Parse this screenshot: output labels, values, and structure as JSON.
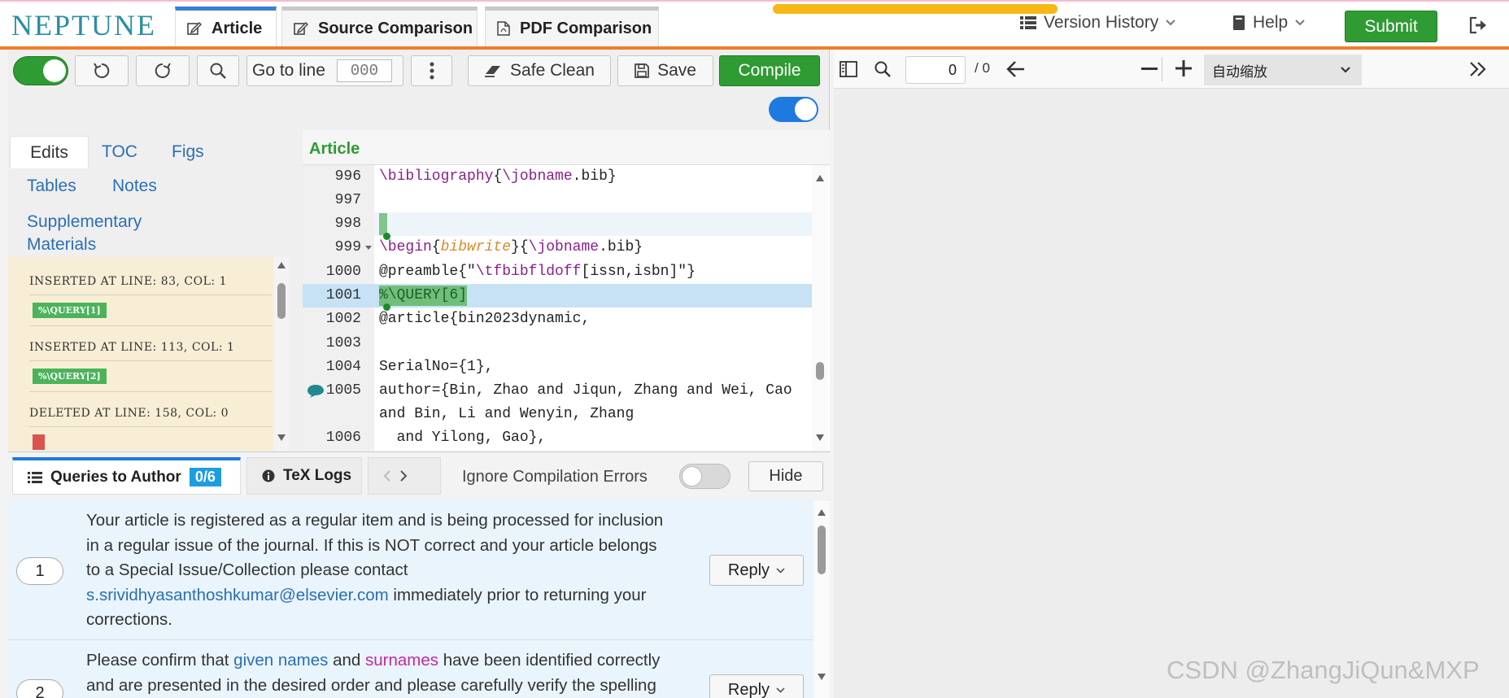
{
  "logo": "NEPTUNE",
  "top_tabs": [
    {
      "label": "Article"
    },
    {
      "label": "Source Comparison"
    },
    {
      "label": "PDF Comparison"
    }
  ],
  "top_menu": {
    "version_history": "Version History",
    "help": "Help",
    "submit": "Submit"
  },
  "toolbar": {
    "goto_label": "Go to line",
    "goto_placeholder": "000",
    "safe_clean": "Safe Clean",
    "save": "Save",
    "compile": "Compile"
  },
  "side_tabs": {
    "edits": "Edits",
    "toc": "TOC",
    "figs": "Figs",
    "tables": "Tables",
    "notes": "Notes",
    "supp_line1": "Supplementary",
    "supp_line2": "Materials"
  },
  "edits": [
    {
      "text": "INSERTED   AT LINE: 83, COL: 1",
      "badge": "%\\QUERY[1]"
    },
    {
      "text": "INSERTED   AT LINE: 113, COL: 1",
      "badge": "%\\QUERY[2]"
    },
    {
      "text": "DELETED   AT LINE: 158, COL: 0",
      "badge": ""
    }
  ],
  "editor": {
    "title": "Article",
    "lines": [
      {
        "n": "996",
        "text": "\\bibliography{\\jobname.bib}"
      },
      {
        "n": "997",
        "text": ""
      },
      {
        "n": "998",
        "text": ""
      },
      {
        "n": "999",
        "text": "\\begin{bibwrite}{\\jobname.bib}"
      },
      {
        "n": "1000",
        "text": "@preamble{\"\\tfbibfldoff[issn,isbn]\"}"
      },
      {
        "n": "1001",
        "text": "%\\QUERY[6]"
      },
      {
        "n": "1002",
        "text": "@article{bin2023dynamic,"
      },
      {
        "n": "1003",
        "text": ""
      },
      {
        "n": "1004",
        "text": "SerialNo={1},"
      },
      {
        "n": "1005",
        "text": "author={Bin, Zhao and Jiqun, Zhang and Wei, Cao"
      },
      {
        "n": "",
        "text": "and Bin, Li and Wenyin, Zhang"
      },
      {
        "n": "1006",
        "text": "  and Yilong, Gao},"
      }
    ]
  },
  "bottom_tabs": {
    "queries": "Queries to Author",
    "queries_badge": "0/6",
    "tex_logs": "TeX Logs",
    "ignore_errors": "Ignore Compilation Errors",
    "hide": "Hide"
  },
  "queries": [
    {
      "num": "1",
      "line1": "Your article is registered as a regular item and is being processed for inclusion",
      "line2": "in a regular issue of the journal. If this is NOT correct and your article belongs",
      "line3": "to a Special Issue/Collection please contact",
      "email": "s.srividhyasanthoshkumar@elsevier.com",
      "line4_rest": " immediately prior to returning your",
      "line5": "corrections.",
      "reply": "Reply"
    },
    {
      "num": "2",
      "pre": "Please confirm that ",
      "given": "given names",
      "mid": " and ",
      "sur": "surnames",
      "post": " have been identified correctly",
      "line2": "and are presented in the desired order and please carefully verify the spelling",
      "reply": "Reply"
    }
  ],
  "pdf": {
    "page": "0",
    "total": "/ 0",
    "zoom": "自动缩放"
  },
  "watermark": "CSDN @ZhangJiQun&MXP",
  "colors": {
    "accent_green": "#2e9b33",
    "brand_teal": "#2b8ea3",
    "toggle_blue": "#1f7ae0",
    "progress_orange": "#f6b816"
  }
}
